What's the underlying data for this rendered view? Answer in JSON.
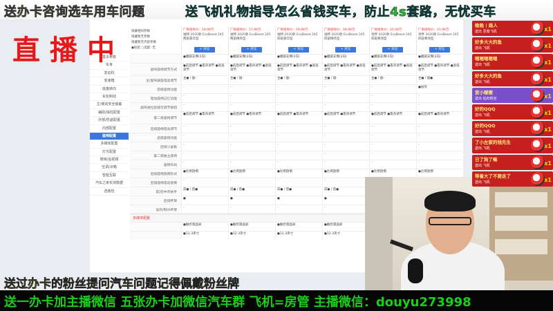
{
  "banners": {
    "top_left": "送办卡咨询选车用车问题",
    "top_right": "送飞机礼物指导怎么省钱买车，防止4s套路，无忧买车",
    "live": "直播中",
    "bottom1": "送过办卡的粉丝提问汽车问题记得佩戴粉丝牌",
    "bottom2": "送一办卡加主播微信 五张办卡加微信汽车群 飞机=房管  主播微信：douyu273998"
  },
  "sidebar": {
    "items": [
      "基本参数",
      "车身",
      "发动机",
      "变速箱",
      "底盘转向",
      "车轮制动",
      "主/被动安全装备",
      "辅助/操控配置",
      "外部/防盗配置",
      "内部配置",
      "座椅配置",
      "多媒体配置",
      "灯光配置",
      "玻璃/后视镜",
      "空调/冰箱",
      "智能互联",
      "汽车之家实测数据",
      "选装包"
    ],
    "active_index": 10
  },
  "header": {
    "options": [
      "隐藏相同参数",
      "隐藏暂无参数",
      "隐藏暂无内容参数",
      "●标配 ○选配 -无"
    ],
    "cars": [
      {
        "price": "厂商指导价：18.98万",
        "name": "福特 2020款 EcoBoost 245 两驱豪华型"
      },
      {
        "price": "厂商指导价：17.98万",
        "name": "福特 2020款 EcoBoost 245 两驱精英型"
      },
      {
        "price": "厂商指导价：19.98万",
        "name": "福特 2020款 EcoBoost 245 四驱豪华型"
      },
      {
        "price": "厂商指导价：18.98万",
        "name": "福特 2020款 EcoBoost 245 四驱精英型"
      },
      {
        "price": "厂商指导价：20.48万",
        "name": "领界 2020款 EcoBoost 245 四驱尊领型"
      },
      {
        "price": "厂商指导价：21.98万",
        "name": "领界 2020款 EcoBoost 245 四驱尊领型"
      }
    ],
    "compare_label": "+ 对比"
  },
  "rows": [
    {
      "label": "",
      "cells": [
        "●腰部支撑(2向)",
        "●腰部支撑(2向)",
        "●腰部支撑(2向)",
        "●腰部支撑(2向)",
        "●腰部支撑(2向)",
        "●腰部支撑(2向)"
      ]
    },
    {
      "label": "副驾座椅调节方式",
      "cells": [
        "●前后调节 ●靠背调节 ●高低调节",
        "●前后调节 ●靠背调节 ●高低调节",
        "●前后调节 ●靠背调节 ●高低调节",
        "●前后调节 ●靠背调节 ●高低调节",
        "●前后调节 ●靠背调节 ●高低调节",
        "●前后调节 ●靠背调节 ●高低调节"
      ]
    },
    {
      "label": "主/副驾驶座电动调节",
      "cells": [
        "主● / 副-",
        "主● / 副-",
        "主● / 副-",
        "主● / 副-",
        "主● / 副-",
        "主● / 副●"
      ]
    },
    {
      "label": "前排座椅功能",
      "cells": [
        "-",
        "-",
        "-",
        "-",
        "-",
        "●加热"
      ]
    },
    {
      "label": "电动座椅记忆功能",
      "cells": [
        "-",
        "-",
        "-",
        "-",
        "-",
        "-"
      ]
    },
    {
      "label": "副驾驶位后排可调节按钮",
      "cells": [
        "-",
        "-",
        "-",
        "-",
        "-",
        "-"
      ]
    },
    {
      "label": "第二排座椅调节",
      "cells": [
        "●前后调节 ●靠背调节",
        "●前后调节 ●靠背调节",
        "●前后调节 ●靠背调节",
        "●前后调节 ●靠背调节",
        "●前后调节 ●靠背调节",
        "●前后调节 ●靠背调节"
      ]
    },
    {
      "label": "后排座椅电动调节",
      "cells": [
        "-",
        "-",
        "-",
        "-",
        "-",
        "-"
      ]
    },
    {
      "label": "后排座椅功能",
      "cells": [
        "-",
        "-",
        "-",
        "-",
        "-",
        "-"
      ]
    },
    {
      "label": "后排小桌板",
      "cells": [
        "-",
        "-",
        "-",
        "-",
        "-",
        "-"
      ]
    },
    {
      "label": "第二排独立座椅",
      "cells": [
        "-",
        "-",
        "-",
        "-",
        "-",
        "-"
      ]
    },
    {
      "label": "座椅布局",
      "cells": [
        "-",
        "-",
        "-",
        "-",
        "-",
        "-"
      ]
    },
    {
      "label": "后排座椅放倒形式",
      "cells": [
        "●比例放倒",
        "●比例放倒",
        "●比例放倒",
        "●比例放倒",
        "●比例放倒",
        "●比例放倒"
      ]
    },
    {
      "label": "后排座椅电动放倒",
      "cells": [
        "-",
        "-",
        "-",
        "-",
        "-",
        "-"
      ]
    },
    {
      "label": "前/后中央扶手",
      "cells": [
        "前● / 后●",
        "前● / 后●",
        "前● / 后●",
        "前● / 后●",
        "前● / 后●",
        "前● / 后●"
      ]
    },
    {
      "label": "后排杯架",
      "cells": [
        "●",
        "●",
        "●",
        "●",
        "●",
        "●"
      ]
    },
    {
      "label": "加热/制冷杯架",
      "cells": [
        "-",
        "-",
        "-",
        "-",
        "-",
        "-"
      ]
    }
  ],
  "section2": "多媒体配置",
  "section2_rows": [
    {
      "label": "",
      "cells": [
        "●触控液晶屏",
        "●触控液晶屏",
        "●触控液晶屏",
        "●触控液晶屏",
        "●触控液晶屏",
        "●触控液晶屏"
      ]
    },
    {
      "label": "",
      "cells": [
        "●12.3英寸",
        "●12.3英寸",
        "●12.3英寸",
        "●12.3英寸",
        "●12.3英寸",
        "●12.3英寸"
      ]
    }
  ],
  "gifts": [
    {
      "who": "晚晚 | 路人",
      "sub": "送出  至尊飞机",
      "count": "x1"
    },
    {
      "who": "好多大大的鱼",
      "sub": "送出  飞机",
      "count": "x1"
    },
    {
      "who": "嗯嗯嗯嗯嗯",
      "sub": "送出  飞机",
      "count": "x1"
    },
    {
      "who": "好多大大的鱼",
      "sub": "送出  飞机",
      "count": "x1"
    },
    {
      "who": "爱小暖暖",
      "sub": "送出  钻石粉丝",
      "count": "x1"
    },
    {
      "who": "好的QQQ",
      "sub": "送出  飞机",
      "count": "x1"
    },
    {
      "who": "好的QQQ",
      "sub": "送出  飞机",
      "count": "x1"
    },
    {
      "who": "了小左家的钱先生",
      "sub": "送出  飞机",
      "count": "x1"
    },
    {
      "who": "日了狗了嘛",
      "sub": "送出  飞机",
      "count": "x1"
    },
    {
      "who": "带着大了不要走了",
      "sub": "送出  飞机",
      "count": "x1"
    }
  ]
}
